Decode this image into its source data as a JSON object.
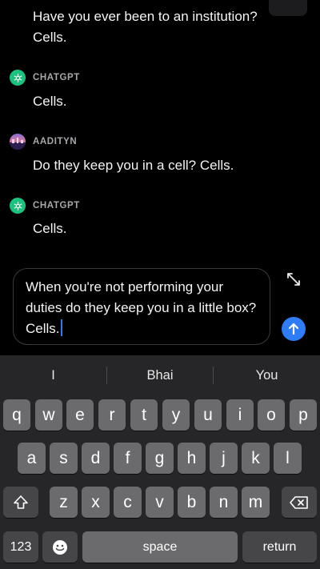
{
  "chat": {
    "messages": [
      {
        "text": "Have you ever been to an institution?"
      },
      {
        "text": "Cells."
      },
      {
        "sender": "CHATGPT",
        "text": "Cells."
      },
      {
        "sender": "AADITYN",
        "text": "Do they keep you in a cell? Cells."
      },
      {
        "sender": "CHATGPT",
        "text": "Cells."
      }
    ]
  },
  "composer": {
    "value": "When you're not performing your duties do they keep you in a little box? Cells.",
    "expand_icon": "expand-arrows-icon",
    "send_icon": "arrow-up-icon",
    "accent_color": "#2f7df6"
  },
  "keyboard": {
    "suggestions": [
      "I",
      "Bhai",
      "You"
    ],
    "row1": [
      "q",
      "w",
      "e",
      "r",
      "t",
      "y",
      "u",
      "i",
      "o",
      "p"
    ],
    "row2": [
      "a",
      "s",
      "d",
      "f",
      "g",
      "h",
      "j",
      "k",
      "l"
    ],
    "row3": [
      "z",
      "x",
      "c",
      "v",
      "b",
      "n",
      "m"
    ],
    "numbers_label": "123",
    "space_label": "space",
    "return_label": "return",
    "shift_icon": "shift-icon",
    "delete_icon": "backspace-icon",
    "emoji_icon": "emoji-icon"
  }
}
